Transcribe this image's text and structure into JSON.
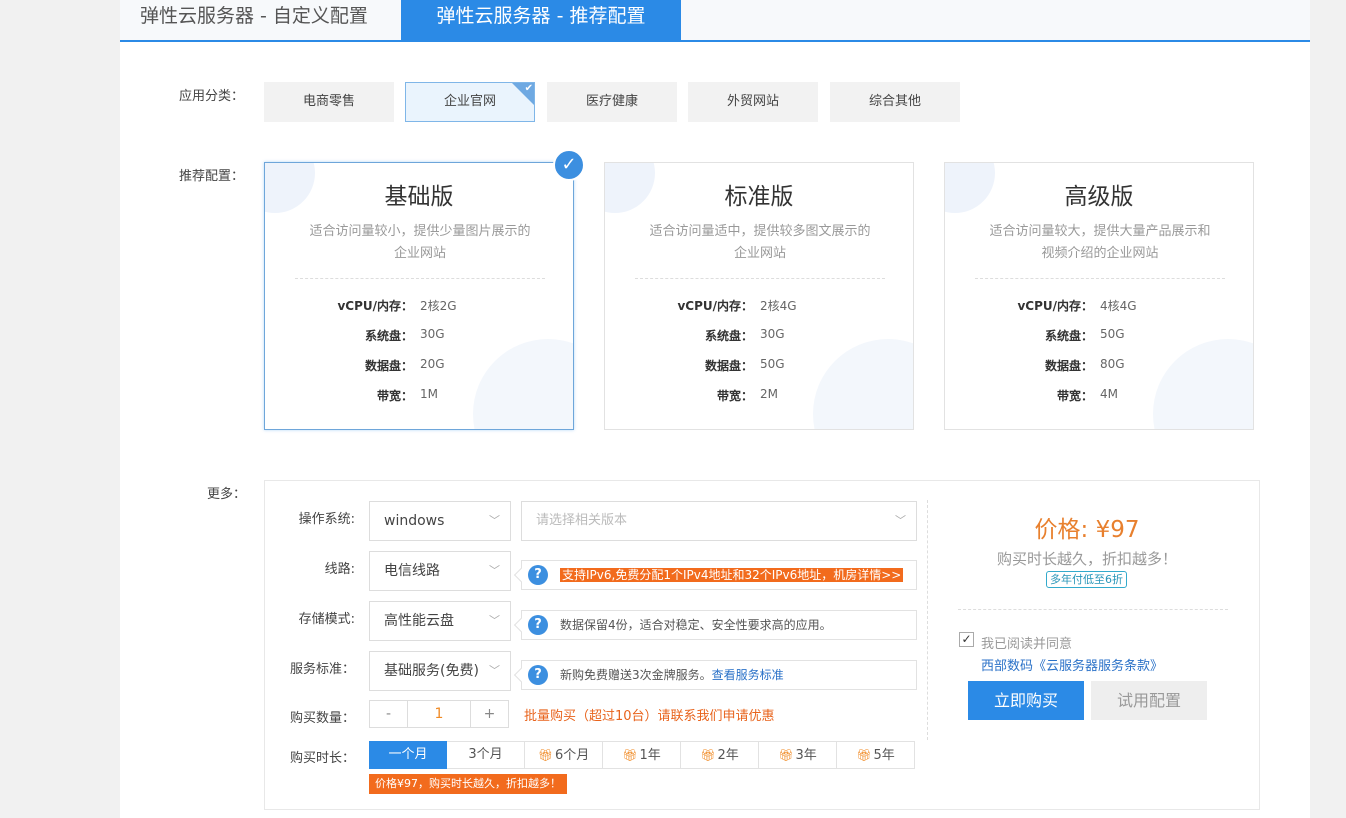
{
  "tabs": [
    {
      "label": "弹性云服务器 - 自定义配置",
      "active": false
    },
    {
      "label": "弹性云服务器 - 推荐配置",
      "active": true
    }
  ],
  "category": {
    "label": "应用分类：",
    "items": [
      "电商零售",
      "企业官网",
      "医疗健康",
      "外贸网站",
      "综合其他"
    ],
    "selected": "企业官网"
  },
  "recommend": {
    "label": "推荐配置：",
    "selected": "基础版",
    "plans": [
      {
        "title": "基础版",
        "desc_line1": "适合访问量较小，提供少量图片展示的",
        "desc_line2": "企业网站",
        "specs": [
          {
            "k": "vCPU/内存：",
            "v": "2核2G"
          },
          {
            "k": "系统盘：",
            "v": "30G"
          },
          {
            "k": "数据盘：",
            "v": "20G"
          },
          {
            "k": "带宽：",
            "v": "1M"
          }
        ]
      },
      {
        "title": "标准版",
        "desc_line1": "适合访问量适中，提供较多图文展示的",
        "desc_line2": "企业网站",
        "specs": [
          {
            "k": "vCPU/内存：",
            "v": "2核4G"
          },
          {
            "k": "系统盘：",
            "v": "30G"
          },
          {
            "k": "数据盘：",
            "v": "50G"
          },
          {
            "k": "带宽：",
            "v": "2M"
          }
        ]
      },
      {
        "title": "高级版",
        "desc_line1": "适合访问量较大，提供大量产品展示和",
        "desc_line2": "视频介绍的企业网站",
        "specs": [
          {
            "k": "vCPU/内存：",
            "v": "4核4G"
          },
          {
            "k": "系统盘：",
            "v": "50G"
          },
          {
            "k": "数据盘：",
            "v": "80G"
          },
          {
            "k": "带宽：",
            "v": "4M"
          }
        ]
      }
    ]
  },
  "more": {
    "label": "更多：",
    "os": {
      "label": "操作系统:",
      "value": "windows",
      "version_placeholder": "请选择相关版本"
    },
    "line": {
      "label": "线路:",
      "value": "电信线路",
      "tip": "支持IPv6,免费分配1个IPv4地址和32个IPv6地址，机房详情>>"
    },
    "storage": {
      "label": "存储模式:",
      "value": "高性能云盘",
      "tip": "数据保留4份，适合对稳定、安全性要求高的应用。"
    },
    "service": {
      "label": "服务标准：",
      "value": "基础服务(免费)",
      "tip": "新购免费赠送3次金牌服务。",
      "tip_link": "查看服务标准"
    },
    "quantity": {
      "label": "购买数量：",
      "minus": "-",
      "value": "1",
      "plus": "+",
      "bulk_note": "批量购买（超过10台）请联系我们申请优惠"
    },
    "duration": {
      "label": "购买时长：",
      "options": [
        {
          "label": "一个月",
          "gift": false
        },
        {
          "label": "3个月",
          "gift": false
        },
        {
          "label": "6个月",
          "gift": true
        },
        {
          "label": "1年",
          "gift": true
        },
        {
          "label": "2年",
          "gift": true
        },
        {
          "label": "3年",
          "gift": true
        },
        {
          "label": "5年",
          "gift": true
        }
      ],
      "selected": "一个月",
      "tip": "价格¥97，购买时长越久，折扣越多！"
    }
  },
  "summary": {
    "price": "价格: ¥97",
    "subtitle": "购买时长越久，折扣越多！",
    "badge": "多年付低至6折",
    "agree_checked": true,
    "agree_text": "我已阅读并同意",
    "terms": "西部数码《云服务器服务条款》",
    "buy": "立即购买",
    "trial": "试用配置"
  },
  "colors": {
    "accent": "#2b8ae6",
    "orange": "#f26b1d",
    "price": "#e8802e",
    "link": "#2b72c8"
  },
  "icons": {
    "check": "check-icon",
    "question": "question-icon",
    "gift": "gift-icon",
    "chevron": "chevron-down-icon"
  }
}
